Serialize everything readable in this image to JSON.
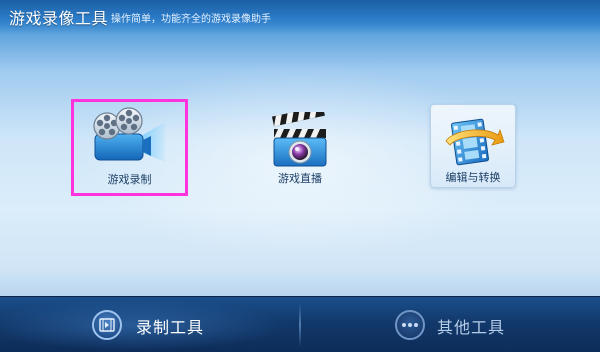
{
  "header": {
    "title": "游戏录像工具",
    "subtitle": "操作简单，功能齐全的游戏录像助手"
  },
  "tools": [
    {
      "label": "游戏录制",
      "icon": "film-camera-icon",
      "selected": true
    },
    {
      "label": "游戏直播",
      "icon": "clapperboard-icon",
      "selected": false
    },
    {
      "label": "编辑与转换",
      "icon": "filmstrip-convert-icon",
      "selected": false
    }
  ],
  "bottom_tabs": [
    {
      "label": "录制工具",
      "icon": "film-icon",
      "active": true
    },
    {
      "label": "其他工具",
      "icon": "more-dots-icon",
      "active": false
    }
  ],
  "colors": {
    "accent": "#2c7cc8",
    "selection_border": "#ff33dd",
    "bottom_bar": "#12396b"
  }
}
